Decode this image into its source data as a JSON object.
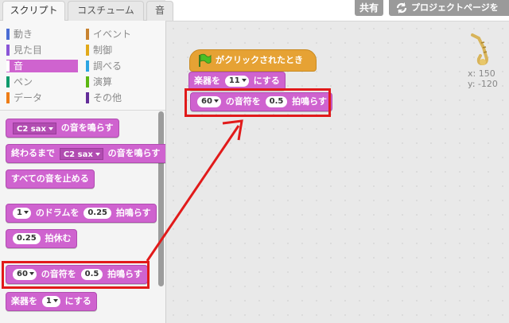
{
  "tabs": [
    {
      "label": "スクリプト",
      "active": true
    },
    {
      "label": "コスチューム",
      "active": false
    },
    {
      "label": "音",
      "active": false
    }
  ],
  "top_buttons": {
    "share": "共有",
    "project_page": "プロジェクトページを"
  },
  "categories": [
    {
      "label": "動き",
      "color": "#4a6cd4"
    },
    {
      "label": "見た目",
      "color": "#8a55d7"
    },
    {
      "label": "音",
      "color": "#bb42c3",
      "active": true
    },
    {
      "label": "ペン",
      "color": "#0e9a6c"
    },
    {
      "label": "データ",
      "color": "#ee7d16"
    },
    {
      "label": "イベント",
      "color": "#c88330"
    },
    {
      "label": "制御",
      "color": "#e1a91a"
    },
    {
      "label": "調べる",
      "color": "#2ca5e2"
    },
    {
      "label": "演算",
      "color": "#5cb712"
    },
    {
      "label": "その他",
      "color": "#632d99"
    }
  ],
  "palette": {
    "play_sound": {
      "sound": "C2 sax",
      "suffix": "の音を鳴らす"
    },
    "play_until_done": {
      "prefix": "終わるまで",
      "sound": "C2 sax",
      "suffix": "の音を鳴らす"
    },
    "stop_all": "すべての音を止める",
    "play_drum": {
      "drum": "1",
      "mid": "のドラムを",
      "beats": "0.25",
      "suffix": "拍鳴らす"
    },
    "rest": {
      "beats": "0.25",
      "suffix": "拍休む"
    },
    "play_note": {
      "note": "60",
      "mid": "の音符を",
      "beats": "0.5",
      "suffix": "拍鳴らす"
    },
    "set_instrument": {
      "prefix": "楽器を",
      "value": "1",
      "suffix": "にする"
    }
  },
  "script": {
    "hat": "がクリックされたとき",
    "set_instrument": {
      "prefix": "楽器を",
      "value": "11",
      "suffix": "にする"
    },
    "play_note": {
      "note": "60",
      "mid": "の音符を",
      "beats": "0.5",
      "suffix": "拍鳴らす"
    }
  },
  "sprite_info": {
    "x": "x: 150",
    "y": "y: -120"
  },
  "colors": {
    "sound": "#cf63cf",
    "events": "#e6a234",
    "highlight": "#e11a1a"
  }
}
